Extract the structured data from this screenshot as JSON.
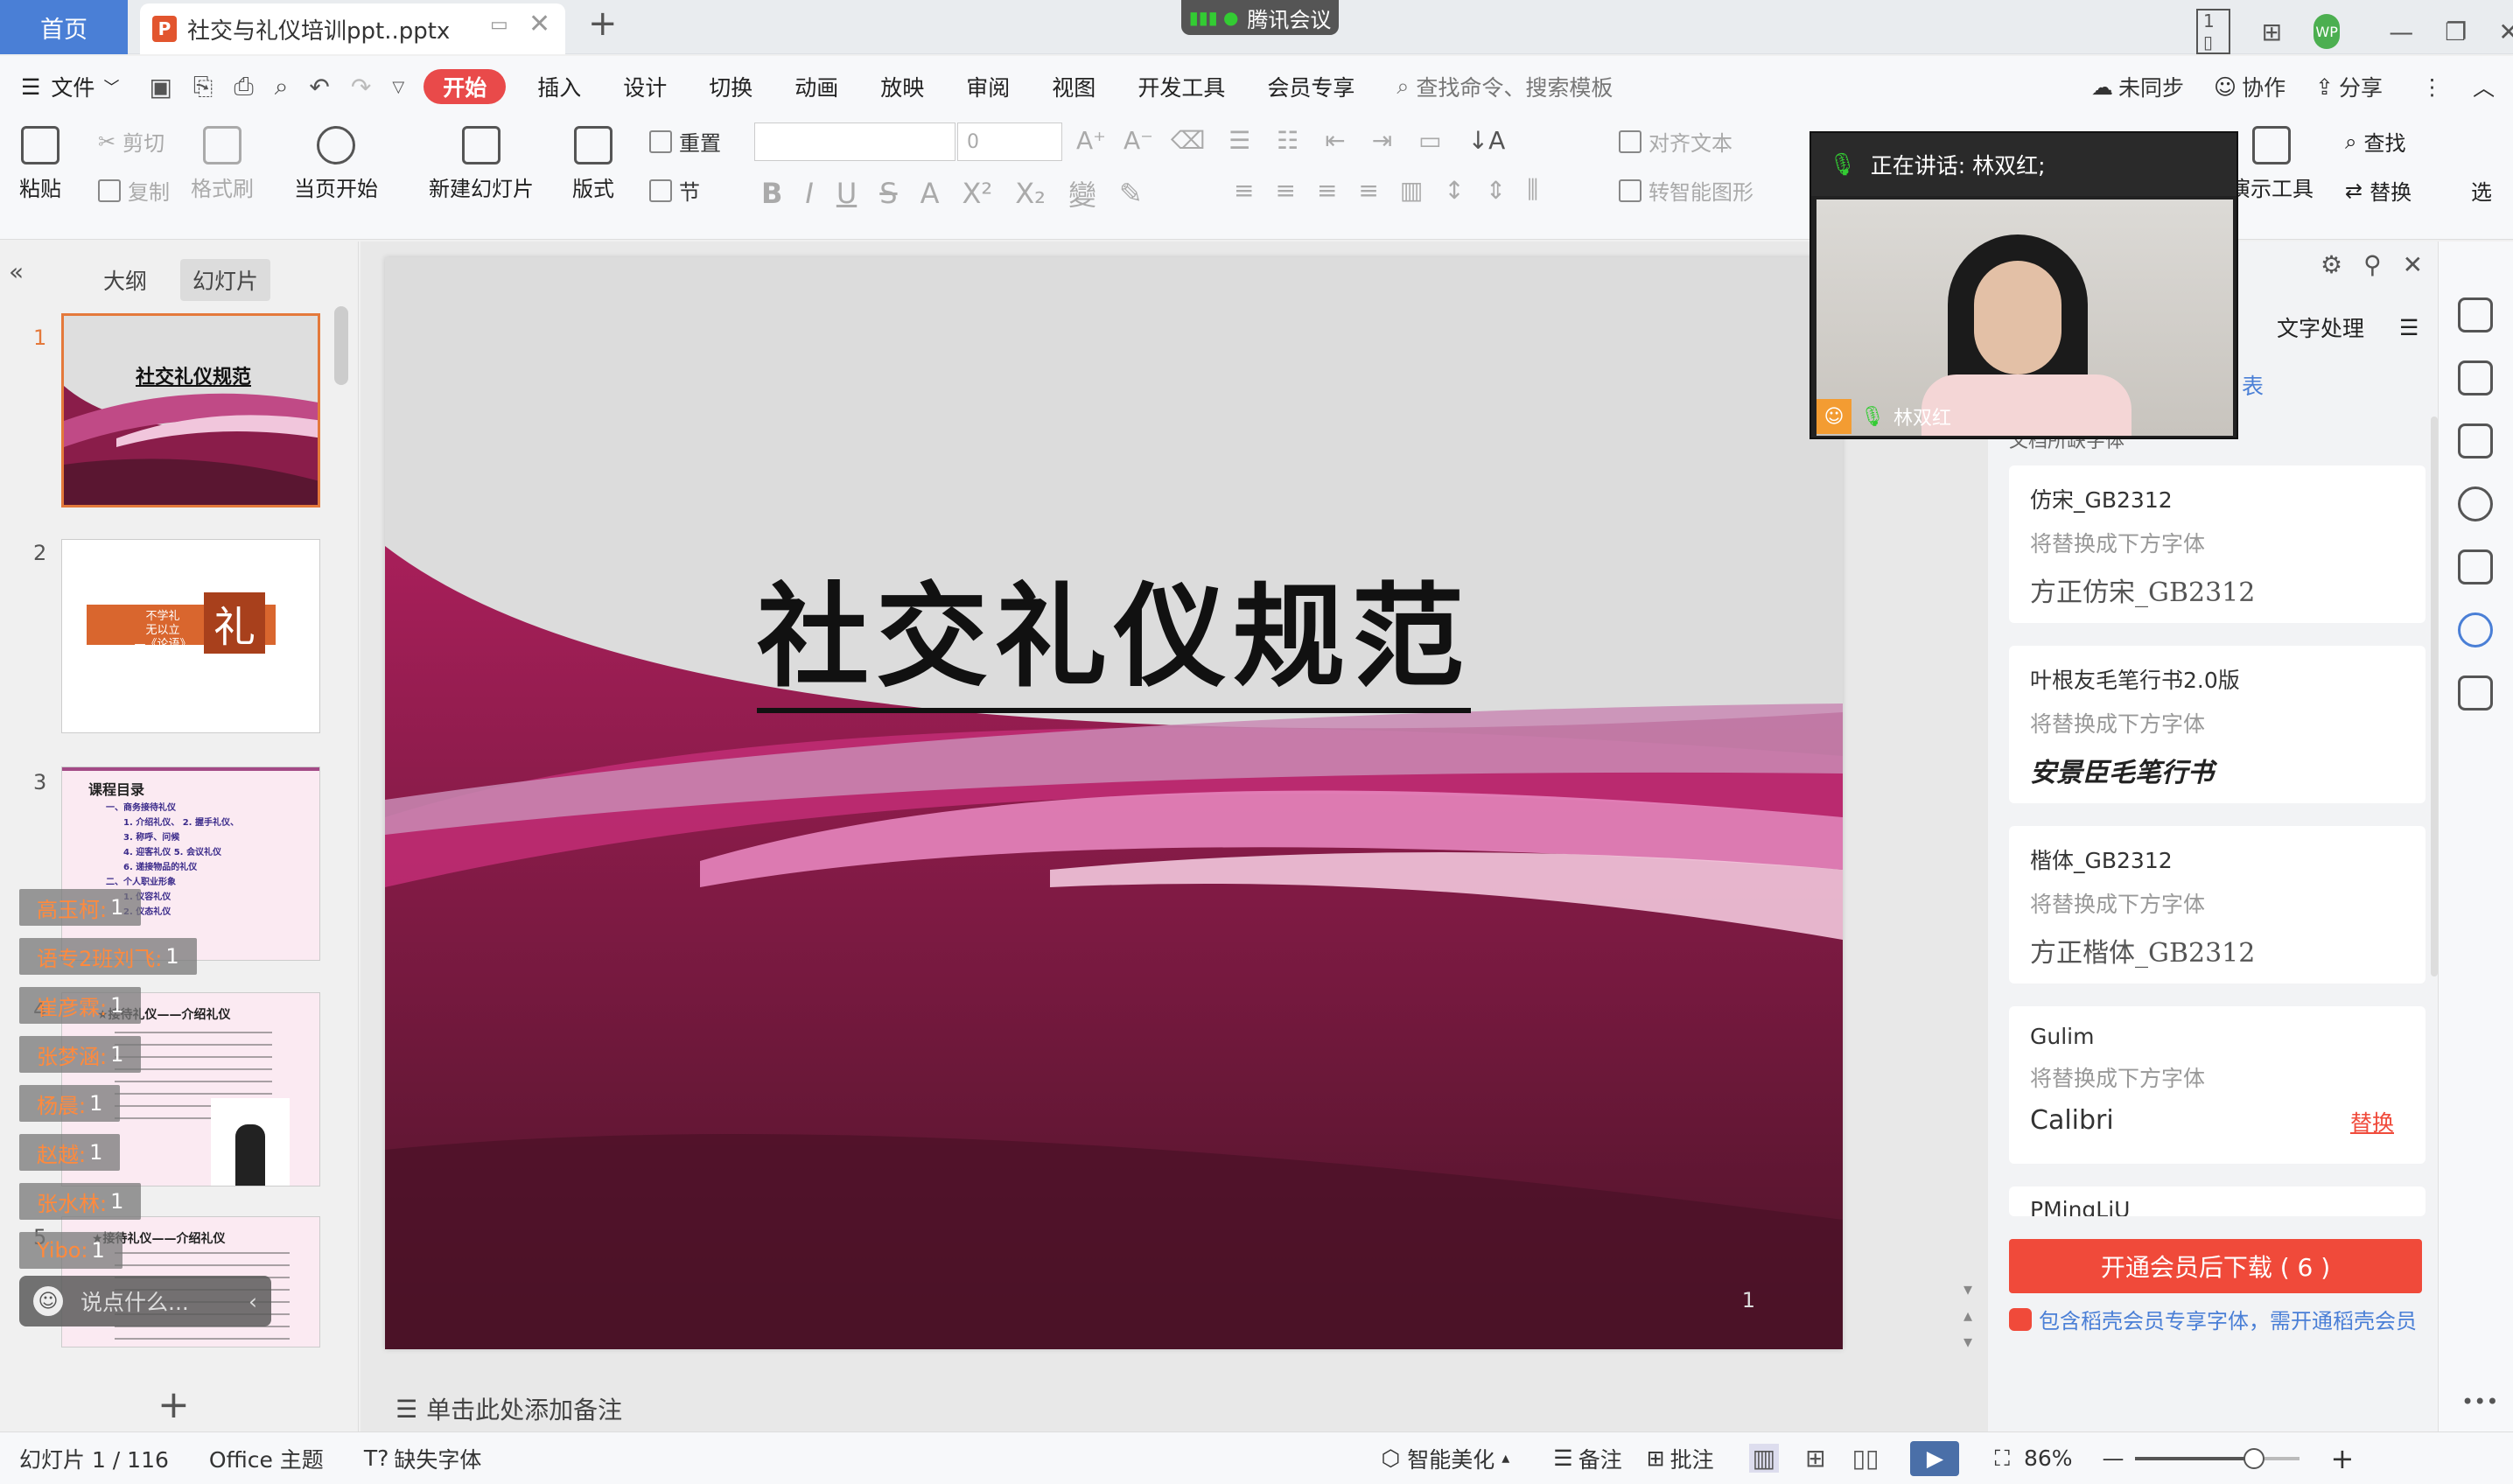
{
  "titlebar": {
    "home_tab": "首页",
    "doc_tab": "社交与礼仪培训ppt..pptx",
    "doc_icon": "P",
    "meeting": "腾讯会议",
    "avatar": "WP"
  },
  "menubar": {
    "file": "文件",
    "items": [
      "开始",
      "插入",
      "设计",
      "切换",
      "动画",
      "放映",
      "审阅",
      "视图",
      "开发工具",
      "会员专享"
    ],
    "search": "查找命令、搜索模板",
    "sync": "未同步",
    "collab": "协作",
    "share": "分享"
  },
  "ribbon": {
    "paste": "粘贴",
    "cut": "剪切",
    "copy": "复制",
    "format_painter": "格式刷",
    "play_current": "当页开始",
    "new_slide": "新建幻灯片",
    "layout": "版式",
    "reset": "重置",
    "section": "节",
    "font_size": "0",
    "align_text": "对齐文本",
    "smart_art": "转智能图形",
    "presenter_tools": "演示工具",
    "find": "查找",
    "replace": "替换",
    "select": "选"
  },
  "left_panel": {
    "tab_outline": "大纲",
    "tab_slides": "幻灯片",
    "thumbnails": [
      {
        "num": "1",
        "title": "社交礼仪规范"
      },
      {
        "num": "2",
        "title": "礼"
      },
      {
        "num": "3",
        "title": "课程目录"
      },
      {
        "num": "4",
        "title": "★接待礼仪——介绍礼仪"
      },
      {
        "num": "5",
        "title": "★接待礼仪——介绍礼仪"
      }
    ],
    "thumb2_lines": [
      "不学礼",
      "无以立",
      "—《论语》"
    ],
    "thumb3_lines": [
      "一、商务接待礼仪",
      "1. 介绍礼仪、 2. 握手礼仪、",
      "3. 称呼、问候",
      "4. 迎客礼仪    5. 会议礼仪",
      "6. 递接物品的礼仪",
      "二、个人职业形象",
      "1. 仪容礼仪",
      "2. 仪态礼仪"
    ],
    "add_slide": "+"
  },
  "chat": {
    "messages": [
      {
        "name": "高玉柯:",
        "count": "1"
      },
      {
        "name": "语专2班刘飞:",
        "count": "1"
      },
      {
        "name": "崔彦霖:",
        "count": "1"
      },
      {
        "name": "张梦涵:",
        "count": "1"
      },
      {
        "name": "杨晨:",
        "count": "1"
      },
      {
        "name": "赵越:",
        "count": "1"
      },
      {
        "name": "张水林:",
        "count": "1"
      },
      {
        "name": "Yibo:",
        "count": "1"
      }
    ],
    "input_placeholder": "说点什么..."
  },
  "slide": {
    "title": "社交礼仪规范",
    "page_number": "1"
  },
  "notes_placeholder": "单击此处添加备注",
  "video": {
    "speaking": "正在讲话: 林双红;",
    "name": "林双红"
  },
  "right_panel": {
    "tab_text": "文字处理",
    "partial_label": "表",
    "section_label": "文档所缺字体",
    "fonts": [
      {
        "name": "仿宋_GB2312",
        "note": "将替换成下方字体",
        "replacement": "方正仿宋_GB2312",
        "action": ""
      },
      {
        "name": "叶根友毛笔行书2.0版",
        "note": "将替换成下方字体",
        "replacement": "安景臣毛笔行书",
        "action": ""
      },
      {
        "name": "楷体_GB2312",
        "note": "将替换成下方字体",
        "replacement": "方正楷体_GB2312",
        "action": ""
      },
      {
        "name": "Gulim",
        "note": "将替换成下方字体",
        "replacement": "Calibri",
        "action": "替换"
      }
    ],
    "partial_font": "PMingLiU",
    "download_button": "开通会员后下载 ( 6 )",
    "member_note": "包含稻壳会员专享字体，需开通稻壳会员"
  },
  "statusbar": {
    "slide_count": "幻灯片 1 / 116",
    "theme": "Office 主题",
    "missing_fonts": "缺失字体",
    "beautify": "智能美化",
    "notes": "备注",
    "comments": "批注",
    "zoom": "86%"
  },
  "colors": {
    "accent_red": "#e94a4a",
    "home_tab_blue": "#4a7fd6",
    "download_red": "#f04a3a",
    "slide_magenta": "#b0245e"
  }
}
